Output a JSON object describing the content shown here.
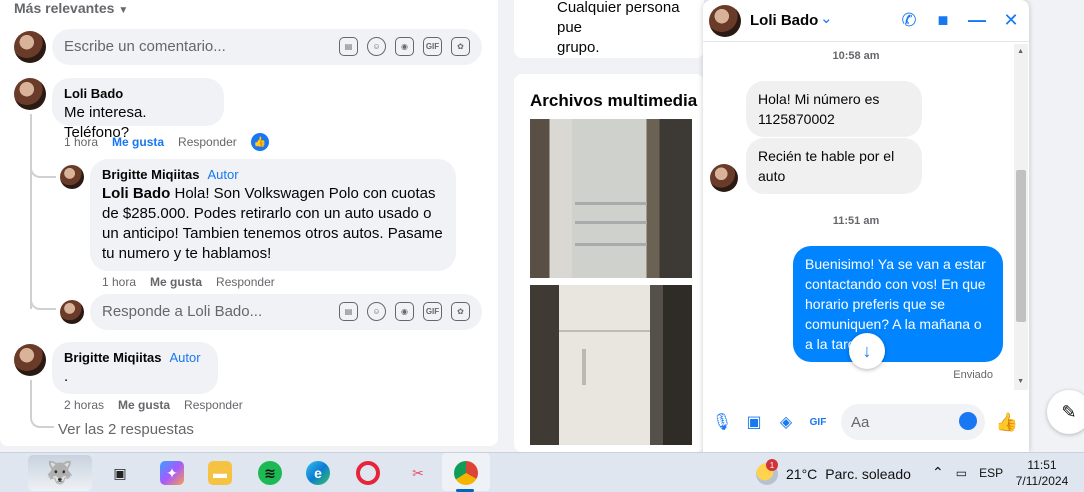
{
  "comments": {
    "sort_label": "Más relevantes",
    "top_input_placeholder": "Escribe un comentario...",
    "comment1": {
      "name": "Loli Bado",
      "text": "Me interesa. Teléfono?",
      "time": "1 hora",
      "like": "Me gusta",
      "reply": "Responder"
    },
    "reply1": {
      "name": "Brigitte Miqiitas",
      "author_badge": "Autor",
      "mention": "Loli Bado",
      "text": " Hola! Son Volkswagen Polo con cuotas de $285.000. Podes retirarlo con un auto usado o un anticipo! Tambien tenemos otros autos. Pasame tu numero y te hablamos!",
      "time": "1 hora",
      "like": "Me gusta",
      "reply": "Responder"
    },
    "reply_input_placeholder": "Responde a Loli Bado...",
    "comment2": {
      "name": "Brigitte Miqiitas",
      "author_badge": "Autor",
      "text": ".",
      "time": "2 horas",
      "like": "Me gusta",
      "reply": "Responder"
    },
    "view_replies": "Ver las 2 respuestas",
    "icons": [
      "sticker-icon",
      "emoji-icon",
      "camera-icon",
      "gif-icon",
      "avatar-sticker-icon"
    ]
  },
  "middle": {
    "top_text_line1": "Cualquier persona pue",
    "top_text_line2": "grupo.",
    "media_title": "Archivos multimedia re"
  },
  "chat": {
    "contact_name": "Loli Bado",
    "time1": "10:58 am",
    "msg_in_1": "Hola! Mi número es 1125870002",
    "msg_in_2": "Recién  te hable por el auto",
    "time2": "11:51 am",
    "msg_out_1": "Buenisimo! Ya se van a estar contactando con vos! En que horario preferis que se comuniquen? A la mañana o a la tarde?",
    "status": "Enviado",
    "composer_placeholder": "Aa",
    "accent_color": "#0084ff"
  },
  "taskbar": {
    "weather_temp": "21°C",
    "weather_desc": "Parc. soleado",
    "weather_badge": "1",
    "language": "ESP",
    "time": "11:51",
    "date": "7/11/2024",
    "apps": [
      "wolf-wallpaper-icon",
      "task-view-icon",
      "copilot-icon",
      "file-explorer-icon",
      "spotify-icon",
      "edge-icon",
      "opera-icon",
      "snipping-tool-icon",
      "chrome-icon"
    ]
  }
}
